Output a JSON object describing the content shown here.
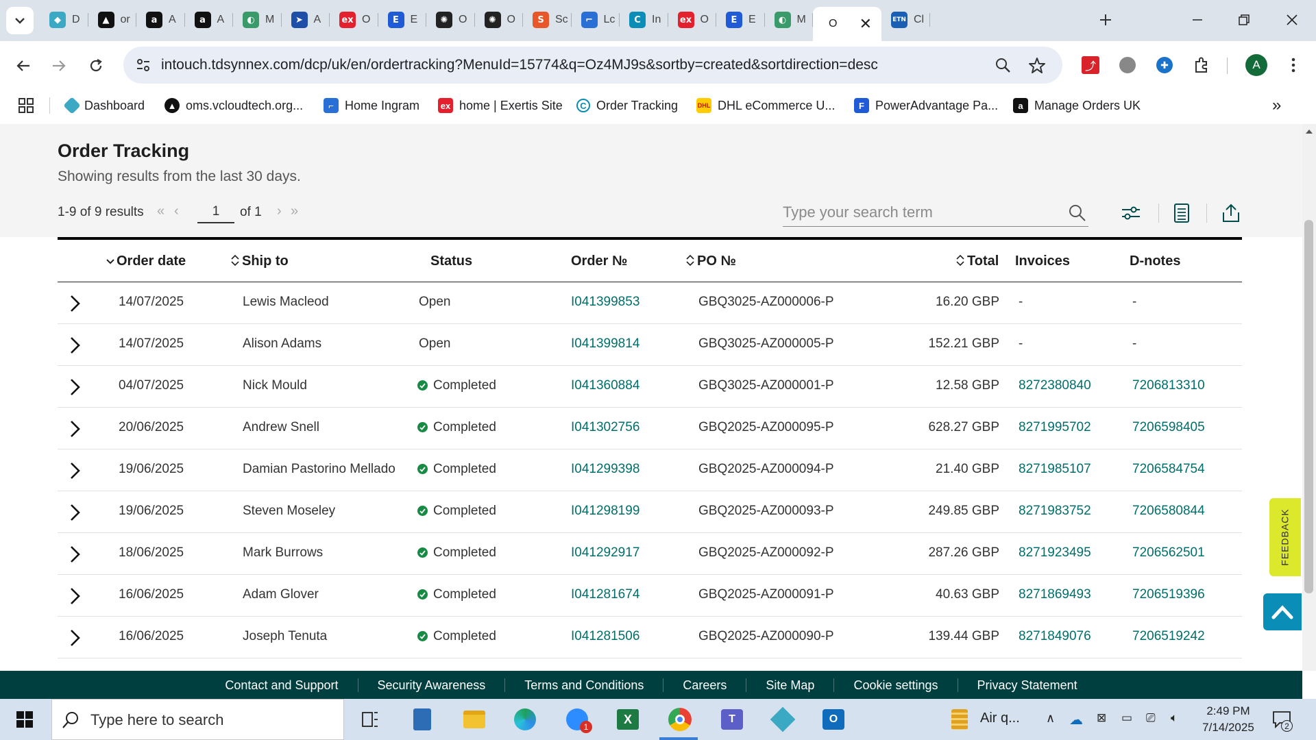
{
  "browser": {
    "tabs": [
      {
        "label": "D",
        "icon": "dashboard-icon"
      },
      {
        "label": "or",
        "icon": "oms-icon"
      },
      {
        "label": "A",
        "icon": "amazon-icon"
      },
      {
        "label": "A",
        "icon": "amazon-icon"
      },
      {
        "label": "M",
        "icon": "m-icon"
      },
      {
        "label": "A",
        "icon": "arrow-icon"
      },
      {
        "label": "O",
        "icon": "exertis-icon"
      },
      {
        "label": "E",
        "icon": "e-icon"
      },
      {
        "label": "O",
        "icon": "openai-icon"
      },
      {
        "label": "O",
        "icon": "openai-icon"
      },
      {
        "label": "Sc",
        "icon": "sc-icon"
      },
      {
        "label": "Lc",
        "icon": "ingram-icon"
      },
      {
        "label": "In",
        "icon": "c-icon"
      },
      {
        "label": "O",
        "icon": "exertis-icon"
      },
      {
        "label": "E",
        "icon": "e-icon"
      },
      {
        "label": "M",
        "icon": "m-icon"
      },
      {
        "label": "O",
        "icon": "tracking-icon",
        "active": true
      },
      {
        "label": "Cl",
        "icon": "etn-icon"
      }
    ],
    "url": "intouch.tdsynnex.com/dcp/uk/en/ordertracking?MenuId=15774&q=Oz4MJ9s&sortby=created&sortdirection=desc",
    "avatar_letter": "A",
    "bookmarks": [
      {
        "label": "Dashboard"
      },
      {
        "label": "oms.vcloudtech.org..."
      },
      {
        "label": "Home Ingram"
      },
      {
        "label": "home | Exertis Site"
      },
      {
        "label": "Order Tracking"
      },
      {
        "label": "DHL eCommerce U..."
      },
      {
        "label": "PowerAdvantage Pa..."
      },
      {
        "label": "Manage Orders UK"
      }
    ]
  },
  "page": {
    "title": "Order Tracking",
    "subtitle": "Showing results from the last 30 days.",
    "results": "1-9 of 9 results",
    "page_number": "1",
    "page_of": "of 1",
    "search_placeholder": "Type your search term"
  },
  "table": {
    "headers": {
      "order_date": "Order date",
      "ship_to": "Ship to",
      "status": "Status",
      "order_no": "Order №",
      "po_no": "PO №",
      "total": "Total",
      "invoices": "Invoices",
      "dnotes": "D-notes"
    },
    "rows": [
      {
        "date": "14/07/2025",
        "ship_to": "Lewis Macleod",
        "status": "Open",
        "order": "I041399853",
        "po": "GBQ3025-AZ000006-P",
        "total": "16.20 GBP",
        "invoice": "-",
        "dnote": "-"
      },
      {
        "date": "14/07/2025",
        "ship_to": "Alison Adams",
        "status": "Open",
        "order": "I041399814",
        "po": "GBQ3025-AZ000005-P",
        "total": "152.21 GBP",
        "invoice": "-",
        "dnote": "-"
      },
      {
        "date": "04/07/2025",
        "ship_to": "Nick Mould",
        "status": "Completed",
        "order": "I041360884",
        "po": "GBQ3025-AZ000001-P",
        "total": "12.58 GBP",
        "invoice": "8272380840",
        "dnote": "7206813310"
      },
      {
        "date": "20/06/2025",
        "ship_to": "Andrew Snell",
        "status": "Completed",
        "order": "I041302756",
        "po": "GBQ2025-AZ000095-P",
        "total": "628.27 GBP",
        "invoice": "8271995702",
        "dnote": "7206598405"
      },
      {
        "date": "19/06/2025",
        "ship_to": "Damian Pastorino Mellado",
        "status": "Completed",
        "order": "I041299398",
        "po": "GBQ2025-AZ000094-P",
        "total": "21.40 GBP",
        "invoice": "8271985107",
        "dnote": "7206584754"
      },
      {
        "date": "19/06/2025",
        "ship_to": "Steven Moseley",
        "status": "Completed",
        "order": "I041298199",
        "po": "GBQ2025-AZ000093-P",
        "total": "249.85 GBP",
        "invoice": "8271983752",
        "dnote": "7206580844"
      },
      {
        "date": "18/06/2025",
        "ship_to": "Mark Burrows",
        "status": "Completed",
        "order": "I041292917",
        "po": "GBQ2025-AZ000092-P",
        "total": "287.26 GBP",
        "invoice": "8271923495",
        "dnote": "7206562501"
      },
      {
        "date": "16/06/2025",
        "ship_to": "Adam Glover",
        "status": "Completed",
        "order": "I041281674",
        "po": "GBQ2025-AZ000091-P",
        "total": "40.63 GBP",
        "invoice": "8271869493",
        "dnote": "7206519396"
      },
      {
        "date": "16/06/2025",
        "ship_to": "Joseph Tenuta",
        "status": "Completed",
        "order": "I041281506",
        "po": "GBQ2025-AZ000090-P",
        "total": "139.44 GBP",
        "invoice": "8271849076",
        "dnote": "7206519242"
      }
    ]
  },
  "feedback_label": "FEEDBACK",
  "footer": {
    "links": [
      "Contact and Support",
      "Security Awareness",
      "Terms and Conditions",
      "Careers",
      "Site Map",
      "Cookie settings",
      "Privacy Statement"
    ]
  },
  "taskbar": {
    "search_placeholder": "Type here to search",
    "weather": "Air q...",
    "time": "2:49 PM",
    "date": "7/14/2025",
    "notification_count": "2",
    "zoom_badge": "1"
  },
  "colors": {
    "link": "#006e6a",
    "footer_bg": "#003f3f",
    "status_completed": "#178a43",
    "feedback_bg": "#dbe82c",
    "back_to_top_bg": "#0a8db6"
  }
}
